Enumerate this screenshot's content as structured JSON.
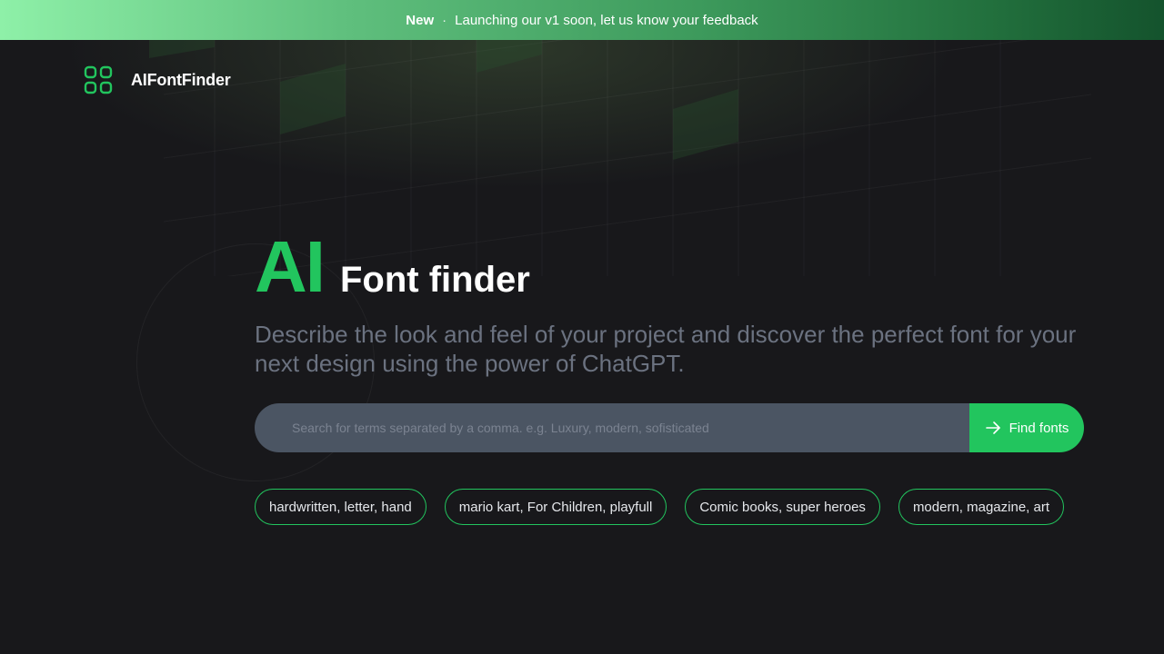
{
  "banner": {
    "badge": "New",
    "separator": "·",
    "message": "Launching our v1 soon, let us know your feedback"
  },
  "header": {
    "logo_icon": "four-squares-icon",
    "brand": "AIFontFinder"
  },
  "hero": {
    "title_accent": "AI",
    "title_rest": "Font finder",
    "subtitle": "Describe the look and feel of your project and discover the perfect font for your next design using the power of ChatGPT."
  },
  "search": {
    "value": "",
    "placeholder": "Search for terms separated by a comma. e.g. Luxury, modern, sofisticated",
    "button_icon": "arrow-right-icon",
    "button_label": "Find fonts"
  },
  "suggestions": [
    "hardwritten, letter, hand",
    "mario kart, For Children, playfull",
    "Comic books, super heroes",
    "modern, magazine, art"
  ],
  "colors": {
    "accent": "#22c55e",
    "background": "#18181b",
    "input_bg": "#4b5563",
    "subtitle": "#6b7280",
    "banner_start": "#8ef0a8",
    "banner_end": "#14532d"
  }
}
